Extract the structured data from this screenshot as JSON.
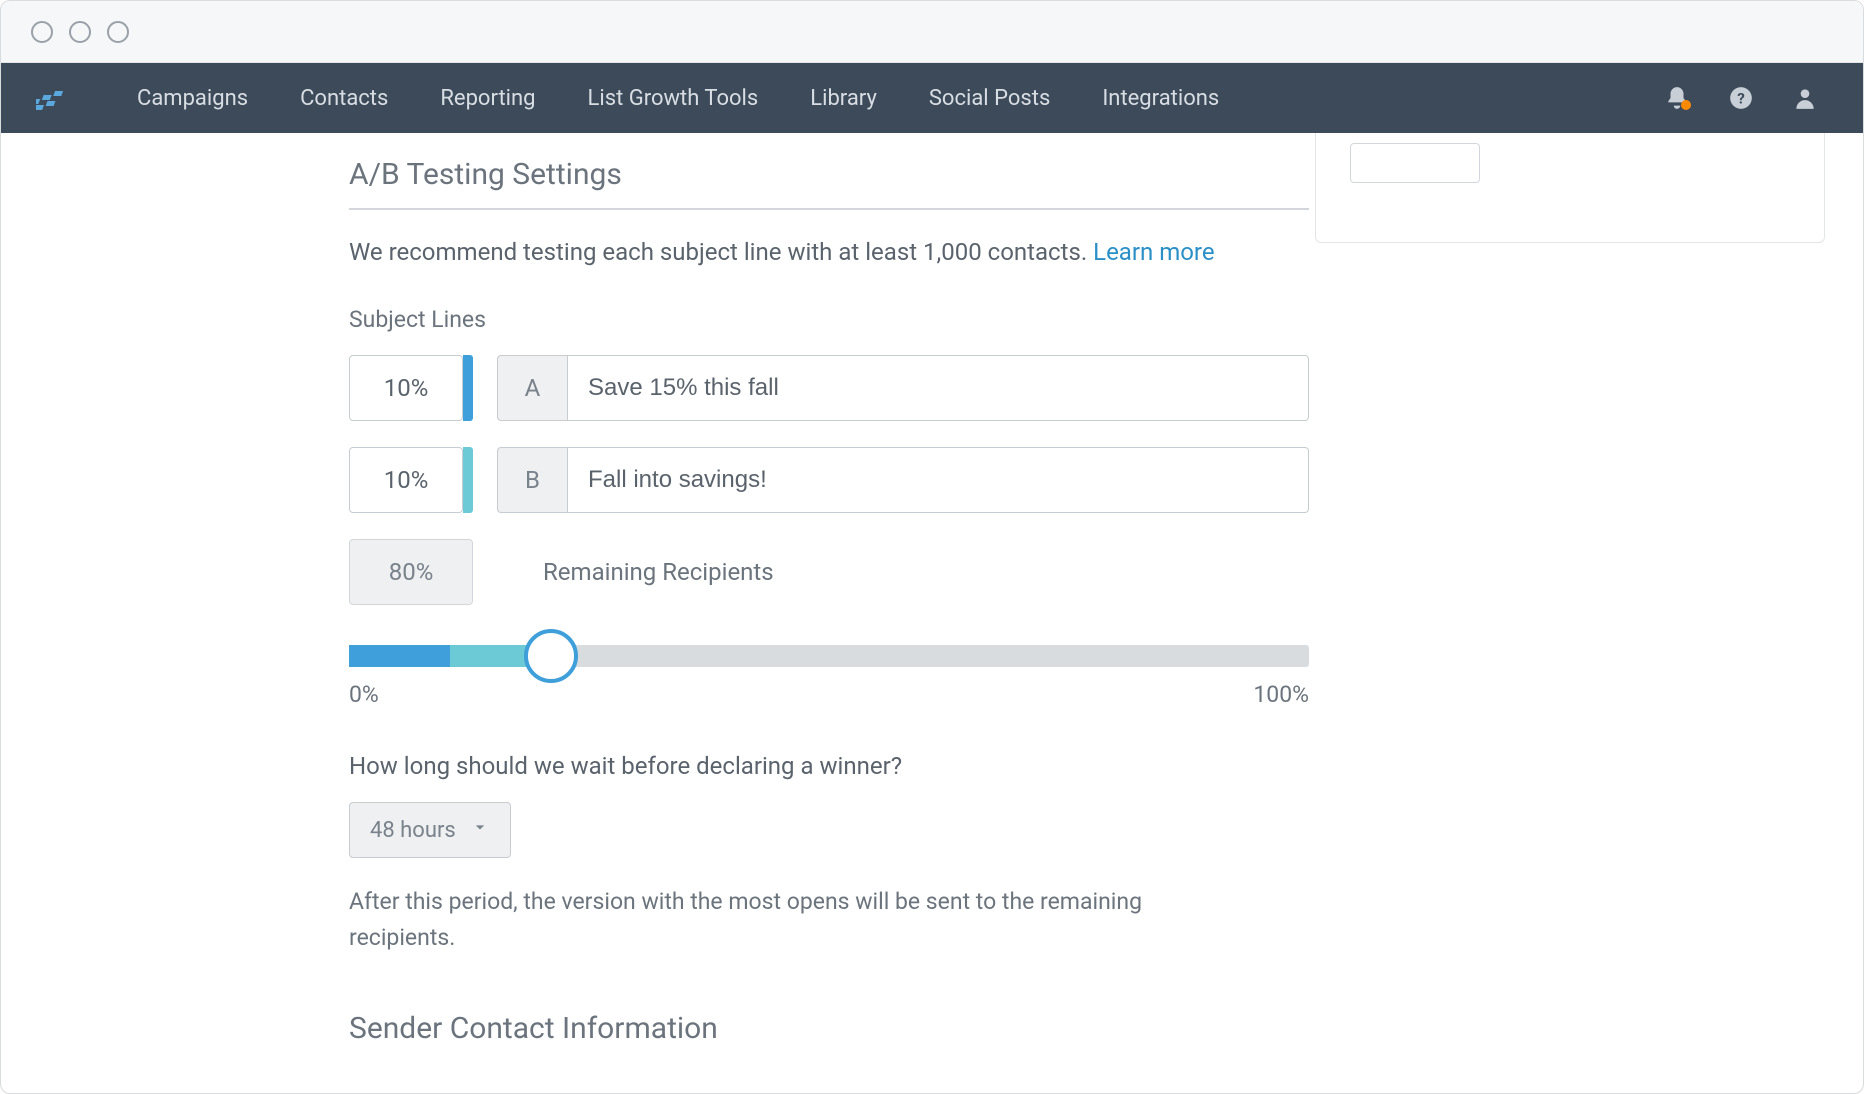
{
  "nav": {
    "items": [
      "Campaigns",
      "Contacts",
      "Reporting",
      "List Growth Tools",
      "Library",
      "Social Posts",
      "Integrations"
    ]
  },
  "ab": {
    "title": "A/B Testing Settings",
    "recommend_text": "We recommend testing each subject line with at least 1,000 contacts. ",
    "learn_more": "Learn more",
    "subject_lines_label": "Subject Lines",
    "variants": [
      {
        "pct": "10%",
        "letter": "A",
        "subject": "Save 15% this fall"
      },
      {
        "pct": "10%",
        "letter": "B",
        "subject": "Fall into savings!"
      }
    ],
    "remaining_pct": "80%",
    "remaining_label": "Remaining Recipients",
    "slider": {
      "min_label": "0%",
      "max_label": "100%"
    },
    "wait_question": "How long should we wait before declaring a winner?",
    "wait_value": "48 hours",
    "after_text": "After this period, the version with the most opens will be sent to the remaining recipients.",
    "next_section_title": "Sender Contact Information"
  }
}
